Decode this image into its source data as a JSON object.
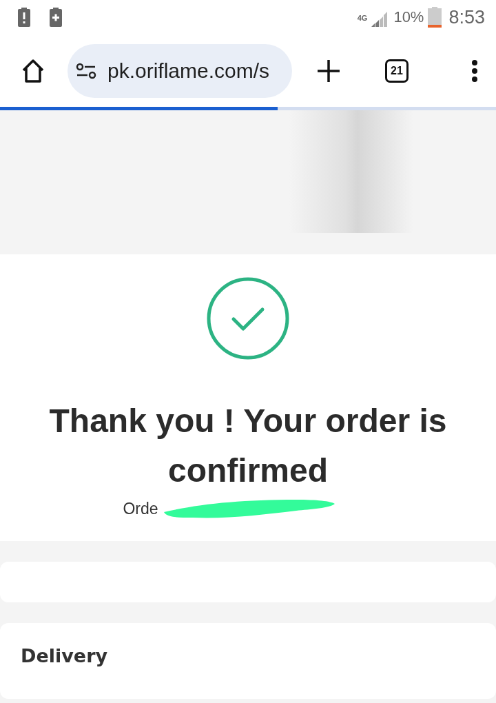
{
  "status_bar": {
    "network": "4G",
    "battery": "10%",
    "time": "8:53"
  },
  "browser": {
    "url": "pk.oriflame.com/s",
    "tab_count": "21",
    "loading": {
      "level": 0.56
    }
  },
  "confirmation": {
    "title": "Thank you ! Your order is confirmed",
    "order_label": "Orde"
  },
  "sections": [
    {
      "kind": "empty"
    },
    {
      "kind": "titled",
      "title": "Delivery"
    }
  ]
}
